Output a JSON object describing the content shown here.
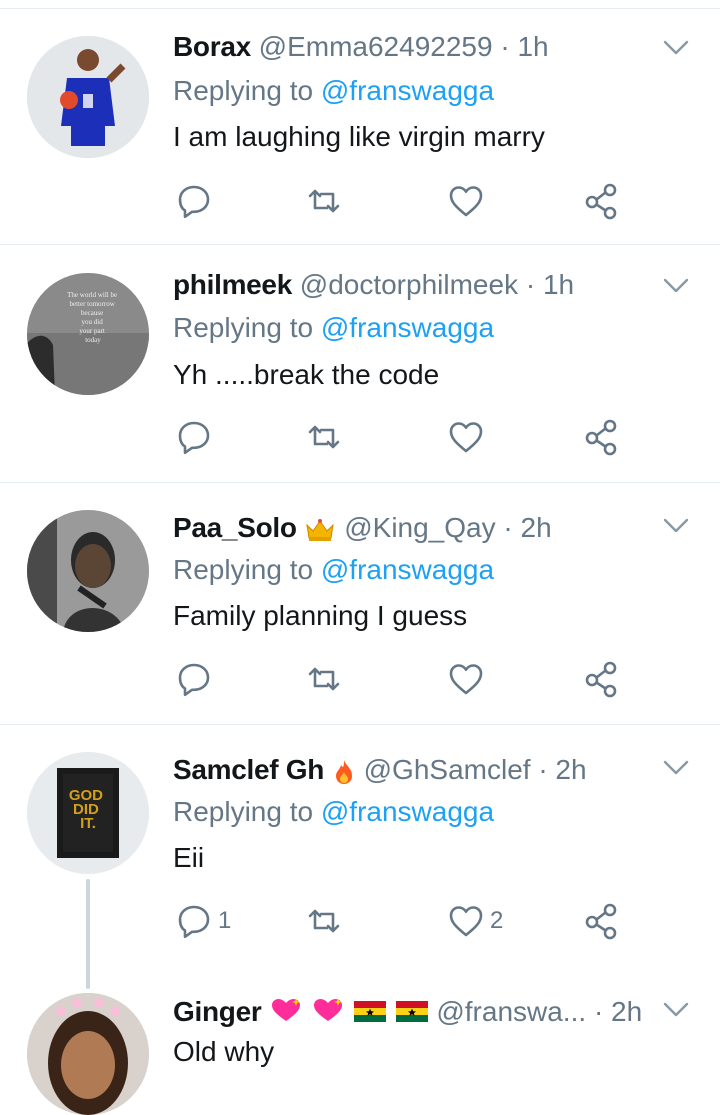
{
  "tweets": [
    {
      "name": "Borax",
      "handle": "@Emma62492259",
      "time": "· 1h",
      "replying_prefix": "Replying to",
      "replying_to": "@franswagga",
      "text": "I am laughing like virgin marry",
      "reply_count": "",
      "retweet_count": "",
      "like_count": ""
    },
    {
      "name": "philmeek",
      "handle": "@doctorphilmeek",
      "time": "· 1h",
      "replying_prefix": "Replying to",
      "replying_to": "@franswagga",
      "text": "Yh .....break the code",
      "avatar_text": "The world will be better tomorrow because you did your part today",
      "reply_count": "",
      "retweet_count": "",
      "like_count": ""
    },
    {
      "name": "Paa_Solo",
      "name_emoji": "crown-emoji",
      "handle": "@King_Qay",
      "time": "· 2h",
      "replying_prefix": "Replying to",
      "replying_to": "@franswagga",
      "text": "Family planning I guess",
      "reply_count": "",
      "retweet_count": "",
      "like_count": ""
    },
    {
      "name": "Samclef Gh",
      "name_emoji": "fire-emoji",
      "handle": "@GhSamclef",
      "time": "· 2h",
      "replying_prefix": "Replying to",
      "replying_to": "@franswagga",
      "text": "Eii",
      "avatar_text": "GOD DID IT.",
      "reply_count": "1",
      "retweet_count": "",
      "like_count": "2"
    },
    {
      "name": "Ginger",
      "name_emoji": "hearts-and-ghana-flags",
      "handle": "@franswa...",
      "time": "· 2h",
      "text": "Old why"
    }
  ],
  "colors": {
    "text": "#14171a",
    "secondary": "#657786",
    "link": "#1da1f2",
    "divider": "#e6ecf0",
    "thread_line": "#ccd6dd"
  },
  "icons": [
    "reply-icon",
    "retweet-icon",
    "like-icon",
    "share-icon",
    "chevron-down-icon"
  ]
}
